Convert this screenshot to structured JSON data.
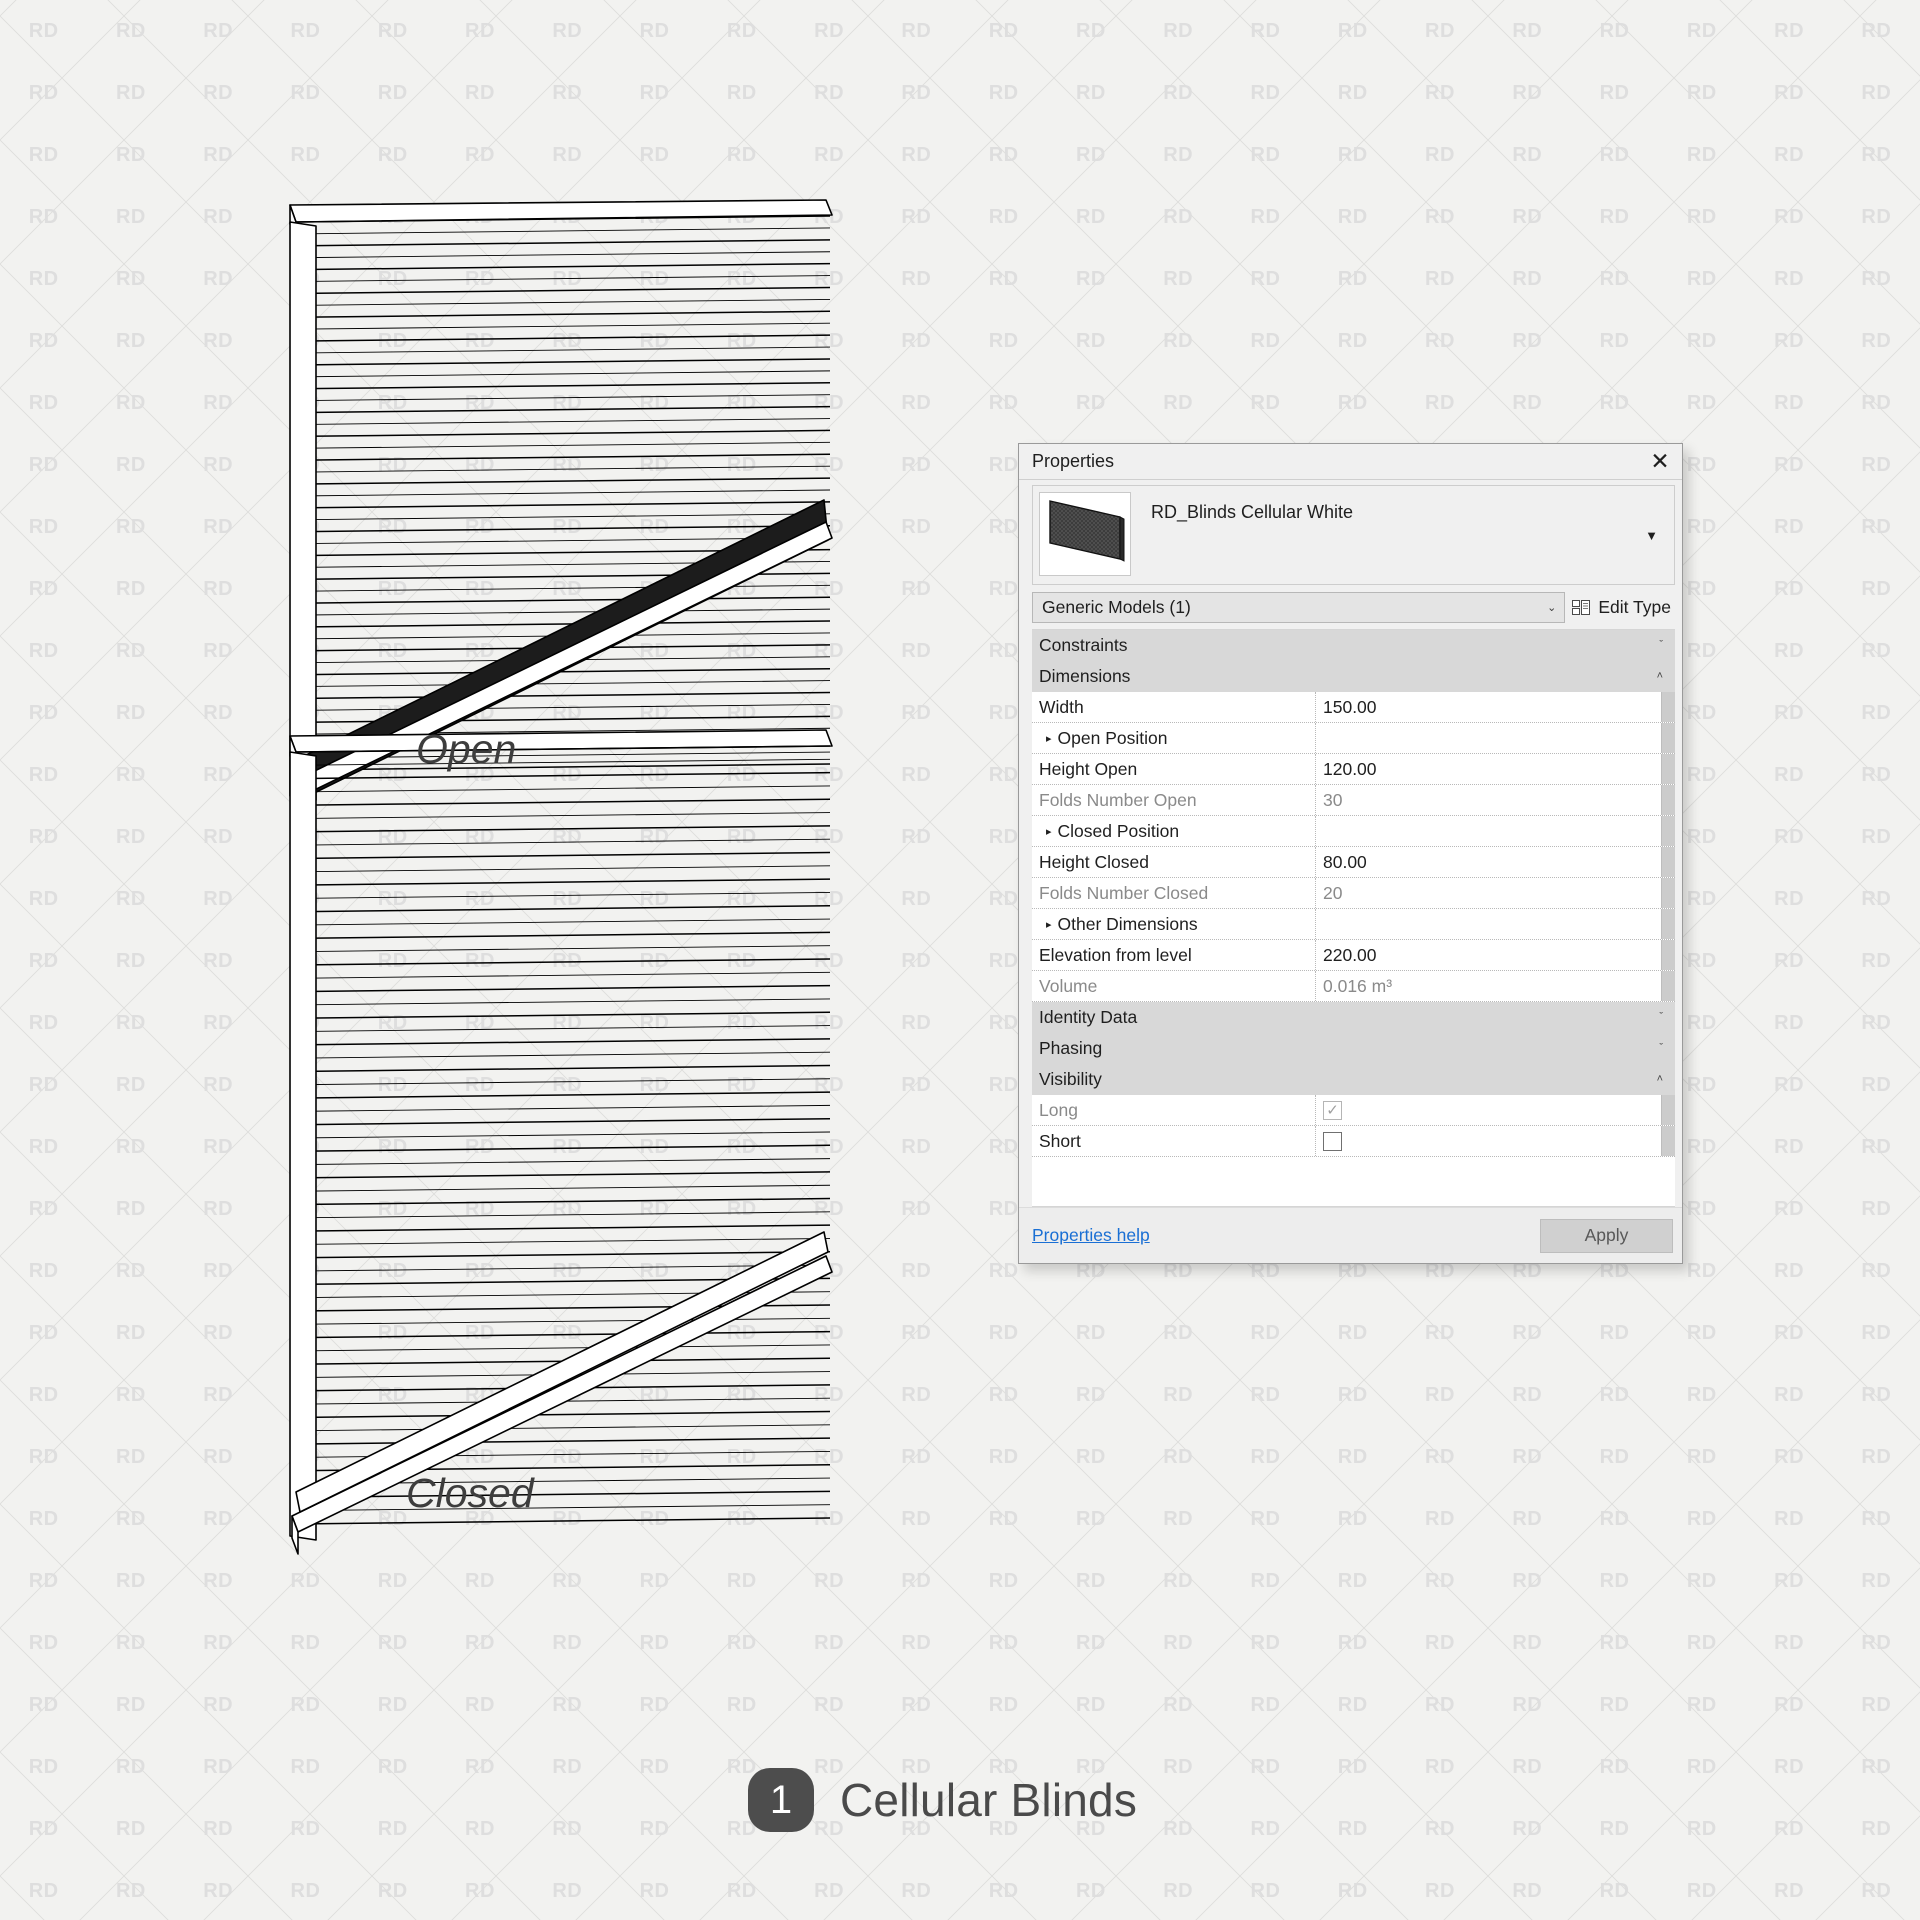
{
  "watermark": {
    "text": "RD"
  },
  "drawing": {
    "labels": {
      "open": "Open",
      "closed": "Closed"
    }
  },
  "bottom_title": {
    "number": "1",
    "text": "Cellular Blinds"
  },
  "properties": {
    "window_title": "Properties",
    "close_label": "✕",
    "type_name": "RD_Blinds Cellular White",
    "type_dropdown_icon": "▼",
    "category_selector": {
      "value": "Generic Models (1)",
      "arrow": "⌄"
    },
    "edit_type": {
      "label": "Edit Type",
      "icon": "edit-type-icon"
    },
    "groups": [
      {
        "name": "Constraints",
        "chevron": "ˇ",
        "rows": []
      },
      {
        "name": "Dimensions",
        "chevron": "˄",
        "rows": [
          {
            "name": "Width",
            "value": "150.00",
            "dim": false,
            "sub": false,
            "type": "text"
          },
          {
            "name": "Open Position",
            "value": "",
            "dim": false,
            "sub": true,
            "type": "text",
            "arrow": "▸"
          },
          {
            "name": "Height Open",
            "value": "120.00",
            "dim": false,
            "sub": false,
            "type": "text"
          },
          {
            "name": "Folds Number Open",
            "value": "30",
            "dim": true,
            "sub": false,
            "type": "text"
          },
          {
            "name": "Closed Position",
            "value": "",
            "dim": false,
            "sub": true,
            "type": "text",
            "arrow": "▸"
          },
          {
            "name": "Height Closed",
            "value": "80.00",
            "dim": false,
            "sub": false,
            "type": "text"
          },
          {
            "name": "Folds Number Closed",
            "value": "20",
            "dim": true,
            "sub": false,
            "type": "text"
          },
          {
            "name": "Other Dimensions",
            "value": "",
            "dim": false,
            "sub": true,
            "type": "text",
            "arrow": "▸"
          },
          {
            "name": "Elevation from level",
            "value": "220.00",
            "dim": false,
            "sub": false,
            "type": "text"
          },
          {
            "name": "Volume",
            "value": "0.016 m³",
            "dim": true,
            "sub": false,
            "type": "text"
          }
        ]
      },
      {
        "name": "Identity Data",
        "chevron": "ˇ",
        "rows": []
      },
      {
        "name": "Phasing",
        "chevron": "ˇ",
        "rows": []
      },
      {
        "name": "Visibility",
        "chevron": "˄",
        "rows": [
          {
            "name": "Long",
            "value": "",
            "dim": true,
            "sub": false,
            "type": "checkbox",
            "checked": true
          },
          {
            "name": "Short",
            "value": "",
            "dim": false,
            "sub": false,
            "type": "checkbox",
            "checked": false
          }
        ]
      }
    ],
    "help_link": "Properties help",
    "apply_button": "Apply"
  },
  "colors": {
    "panel_bg": "#f0f0f0",
    "group_bg": "#d8d8d8",
    "link": "#1a6fd4",
    "badge": "#4d4d4d",
    "canvas": "#f2f2f0"
  }
}
